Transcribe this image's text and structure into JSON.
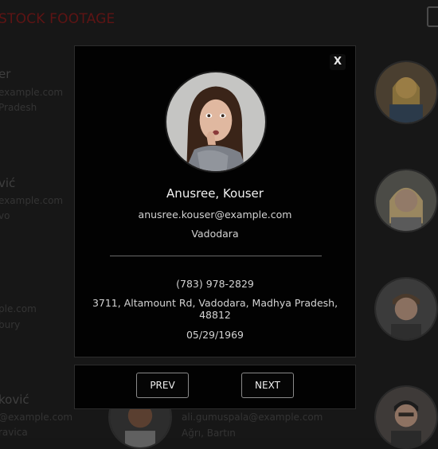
{
  "app": {
    "brand": "STOCK FOOTAGE"
  },
  "background_cards": [
    {
      "name": "er",
      "email": "example.com",
      "location": "Pradesh"
    },
    {
      "name": "vić",
      "email": "example.com",
      "location": "vo"
    },
    {
      "name": "",
      "email": "ple.com",
      "location": "bury"
    },
    {
      "name": "ković",
      "email": "@example.com",
      "location": "ravica"
    }
  ],
  "background_bottom": {
    "email": "ali.gumuspala@example.com",
    "location": "Ağrı, Bartın"
  },
  "modal": {
    "close_label": "X",
    "name": "Anusree, Kouser",
    "email": "anusree.kouser@example.com",
    "city": "Vadodara",
    "phone": "(783) 978-2829",
    "address": "3711, Altamount Rd, Vadodara, Madhya Pradesh, 48812",
    "dob": "05/29/1969"
  },
  "footer": {
    "prev_label": "PREV",
    "next_label": "NEXT"
  },
  "colors": {
    "brand": "#5e1414",
    "modal_bg": "#020202",
    "page_bg": "#171717"
  }
}
